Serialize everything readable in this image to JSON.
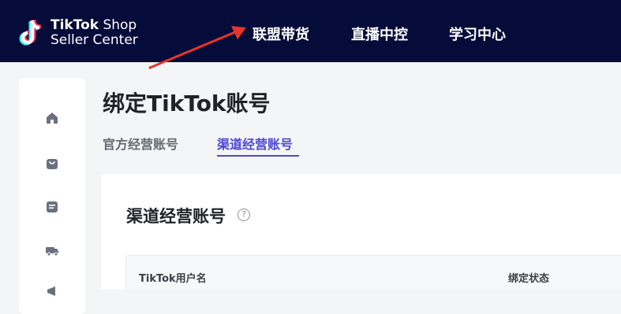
{
  "brand": {
    "name_bold": "TikTok",
    "name_rest": " Shop",
    "subtitle": "Seller Center"
  },
  "nav": {
    "items": [
      {
        "label": "联盟带货"
      },
      {
        "label": "直播中控"
      },
      {
        "label": "学习中心"
      }
    ]
  },
  "sidebar": {
    "icons": [
      "home-icon",
      "shopping-bag-icon",
      "orders-icon",
      "truck-icon",
      "marketing-icon"
    ]
  },
  "page": {
    "title": "绑定TikTok账号",
    "tabs": [
      {
        "label": "官方经营账号",
        "active": false
      },
      {
        "label": "渠道经营账号",
        "active": true
      }
    ]
  },
  "card": {
    "title": "渠道经营账号",
    "help": "?",
    "table": {
      "columns": [
        "TikTok用户名",
        "绑定状态"
      ]
    }
  },
  "colors": {
    "topbar": "#050c3a",
    "accent": "#4b46d6",
    "arrow": "#e8342a"
  }
}
